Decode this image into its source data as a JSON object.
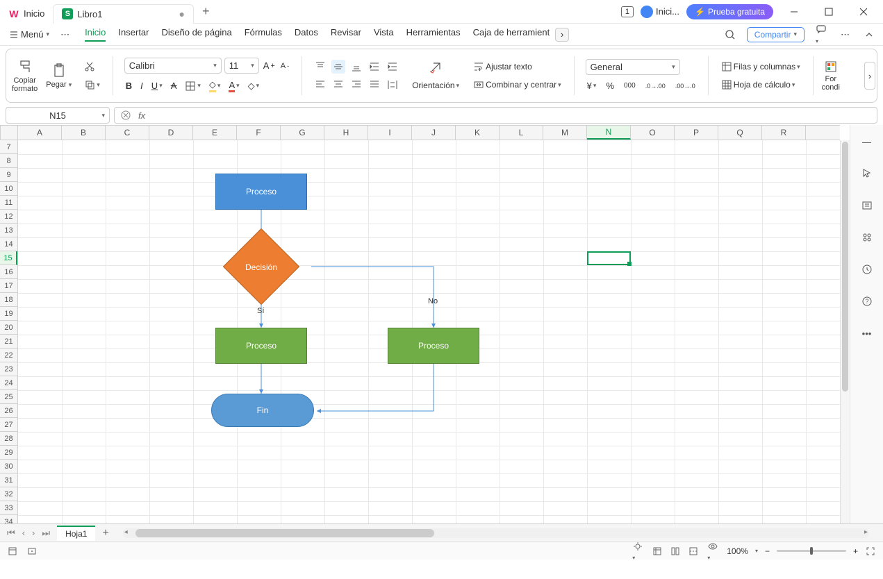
{
  "titlebar": {
    "home_tab": "Inicio",
    "doc_tab": "Libro1",
    "doc_icon": "S",
    "user_label": "Inici...",
    "trial_label": "Prueba gratuita",
    "window_count": "1"
  },
  "menubar": {
    "menu_btn": "Menú",
    "tabs": [
      "Inicio",
      "Insertar",
      "Diseño de página",
      "Fórmulas",
      "Datos",
      "Revisar",
      "Vista",
      "Herramientas",
      "Caja de herramient"
    ],
    "share_btn": "Compartir"
  },
  "ribbon": {
    "copy_format": "Copiar\nformato",
    "paste": "Pegar",
    "font_name": "Calibri",
    "font_size": "11",
    "wrap_text": "Ajustar texto",
    "merge": "Combinar y centrar",
    "orientation": "Orientación",
    "number_format": "General",
    "rows_cols": "Filas y columnas",
    "worksheet": "Hoja de cálculo",
    "cond_format": "For\ncondi"
  },
  "formula_bar": {
    "name_box": "N15"
  },
  "grid": {
    "columns": [
      "A",
      "B",
      "C",
      "D",
      "E",
      "F",
      "G",
      "H",
      "I",
      "J",
      "K",
      "L",
      "M",
      "N",
      "O",
      "P",
      "Q",
      "R"
    ],
    "active_col": "N",
    "row_start": 7,
    "row_end": 35,
    "active_row": 15,
    "sheet_name": "Hoja1"
  },
  "flowchart": {
    "proceso1": "Proceso",
    "decision": "Decisión",
    "si": "Sí",
    "no": "No",
    "proceso2": "Proceso",
    "proceso3": "Proceso",
    "fin": "Fin"
  },
  "status": {
    "zoom": "100%"
  }
}
